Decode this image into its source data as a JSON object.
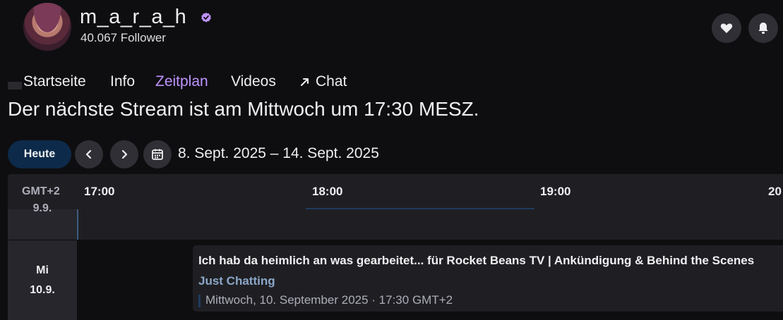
{
  "channel": {
    "name": "m_a_r_a_h",
    "followers": "40.067 Follower",
    "accent_color": "#bf94ff"
  },
  "actions": {
    "follow_icon": "heart-icon",
    "notify_icon": "bell-icon"
  },
  "nav": {
    "items": [
      {
        "label": "Startseite"
      },
      {
        "label": "Info"
      },
      {
        "label": "Zeitplan",
        "active": true
      },
      {
        "label": "Videos"
      },
      {
        "label": "Chat",
        "icon": "external-arrow-icon"
      }
    ]
  },
  "schedule": {
    "next_stream": "Der nächste Stream ist am Mittwoch um 17:30 MESZ.",
    "today_label": "Heute",
    "date_range": "8. Sept. 2025 – 14. Sept. 2025",
    "timezone": "GMT+2",
    "times": [
      "17:00",
      "18:00",
      "19:00",
      "20"
    ],
    "days": [
      {
        "label": "9.9."
      },
      {
        "label_line1": "Mi",
        "label_line2": "10.9."
      }
    ],
    "event": {
      "title": "Ich hab da heimlich an was gearbeitet... für Rocket Beans TV | Ankündigung & Behind the Scenes",
      "category": "Just Chatting",
      "datetime": "Mittwoch, 10. September 2025 · 17:30 GMT+2"
    }
  }
}
